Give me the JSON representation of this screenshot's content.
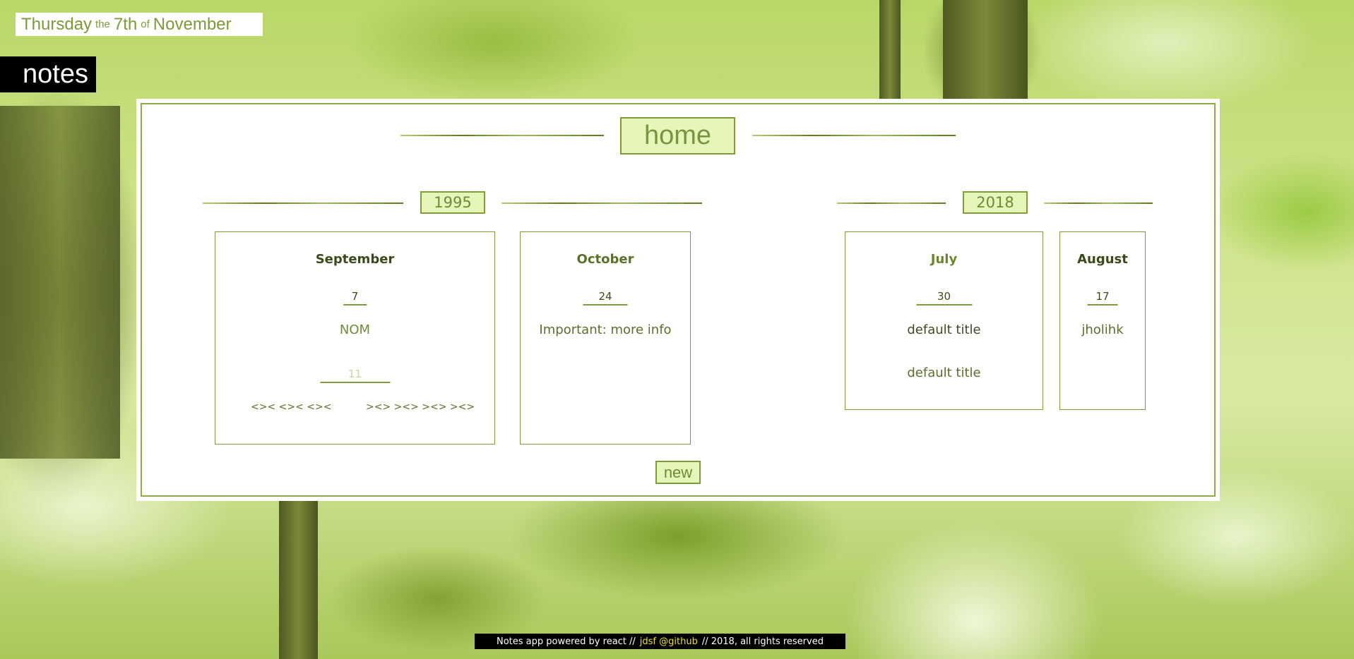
{
  "date": {
    "weekday": "Thursday",
    "the_word": "the",
    "day": "7th",
    "of_word": "of",
    "month": "November"
  },
  "app_title": "notes",
  "page_title": "home",
  "years": [
    {
      "year": "1995",
      "months": [
        {
          "month": "September",
          "days": [
            {
              "day": "7",
              "notes": [
                "NOM"
              ]
            },
            {
              "day": "11",
              "notes": [
                "<>< <>< <><",
                "><> ><> ><> ><>"
              ]
            }
          ]
        },
        {
          "month": "October",
          "days": [
            {
              "day": "24",
              "notes": [
                "Important: more info"
              ]
            }
          ]
        }
      ]
    },
    {
      "year": "2018",
      "months": [
        {
          "month": "July",
          "days": [
            {
              "day": "30",
              "notes": [
                "default title",
                "default title"
              ]
            }
          ]
        },
        {
          "month": "August",
          "days": [
            {
              "day": "17",
              "notes": [
                "jholihk"
              ]
            }
          ]
        }
      ]
    }
  ],
  "new_button_label": "new",
  "footer": {
    "prefix": "Notes app powered by react //",
    "link": "jdsf @github",
    "suffix": "// 2018, all rights reserved"
  },
  "colors": {
    "accent_fill": "#e6f6b8",
    "accent_border": "#7f9c3d",
    "footer_link": "#e8e22a"
  }
}
